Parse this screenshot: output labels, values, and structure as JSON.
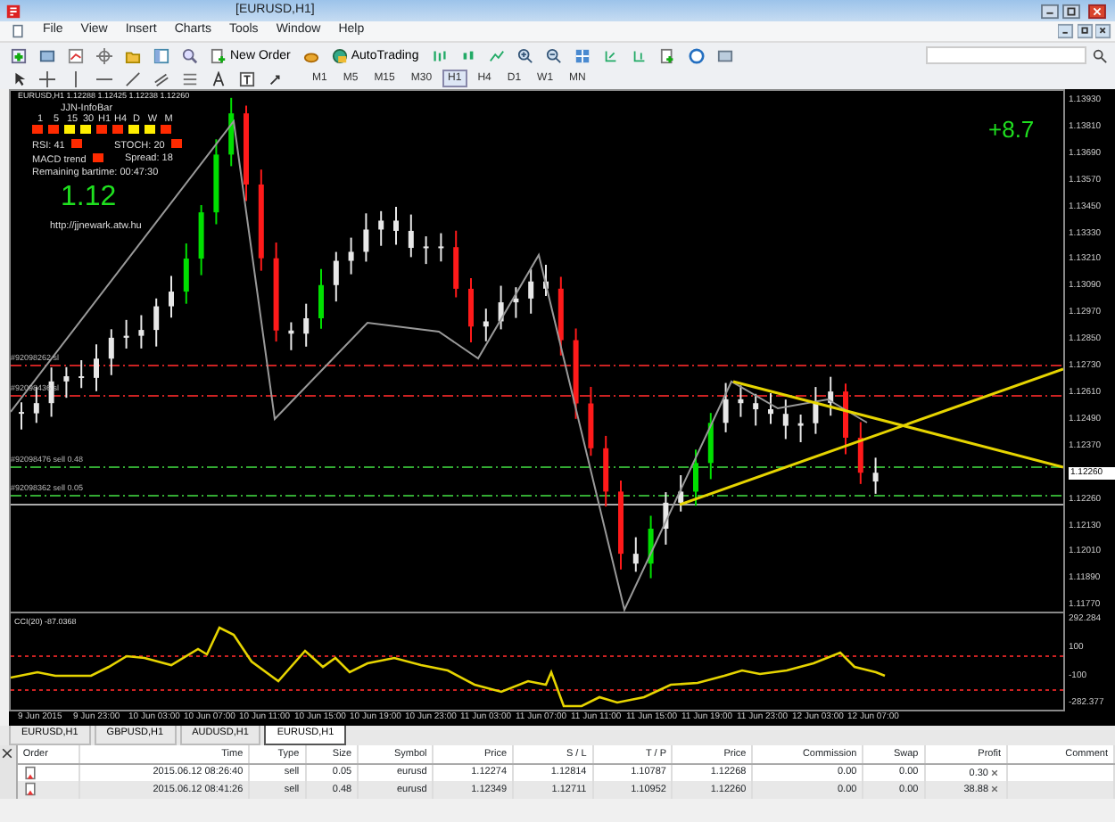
{
  "window": {
    "title": "[EURUSD,H1]"
  },
  "menu": [
    "File",
    "View",
    "Insert",
    "Charts",
    "Tools",
    "Window",
    "Help"
  ],
  "toolbar": {
    "buttons": [
      "New Order",
      "AutoTrading"
    ]
  },
  "periods": [
    {
      "label": "M1",
      "selected": false
    },
    {
      "label": "M5",
      "selected": false
    },
    {
      "label": "M15",
      "selected": false
    },
    {
      "label": "M30",
      "selected": false
    },
    {
      "label": "H1",
      "selected": true
    },
    {
      "label": "H4",
      "selected": false
    },
    {
      "label": "D1",
      "selected": false
    },
    {
      "label": "W1",
      "selected": false
    },
    {
      "label": "MN",
      "selected": false
    }
  ],
  "chart": {
    "header": "EURUSD,H1  1.12288 1.12425 1.12238 1.12260",
    "infobar": {
      "title": "JJN-InfoBar",
      "timeframes": [
        {
          "label": "1",
          "color": "#ff2a00"
        },
        {
          "label": "5",
          "color": "#ff2a00"
        },
        {
          "label": "15",
          "color": "#ffee00"
        },
        {
          "label": "30",
          "color": "#ffee00"
        },
        {
          "label": "H1",
          "color": "#ff2a00"
        },
        {
          "label": "H4",
          "color": "#ff2a00"
        },
        {
          "label": "D",
          "color": "#ffee00"
        },
        {
          "label": "W",
          "color": "#ffee00"
        },
        {
          "label": "M",
          "color": "#ff2a00"
        }
      ],
      "signals": [
        {
          "label": "RSI: 41",
          "color": "#ff2a00"
        },
        {
          "label": "STOCH: 20",
          "color": "#ff2a00"
        },
        {
          "label": "MACD trend",
          "color": "#ff2a00"
        }
      ],
      "spread": "Spread: 18",
      "bartime": "Remaining bartime:  00:47:30",
      "value": "1.12",
      "url": "http://jjnewark.atw.hu"
    },
    "profit": "+8.7",
    "order_lines": [
      "#92098262 sl",
      "#92098436 sl",
      "#92098476 sell 0.48",
      "#92098362 sell 0.05"
    ],
    "price_axis": [
      "1.13930",
      "1.13810",
      "1.13690",
      "1.13570",
      "1.13450",
      "1.13330",
      "1.13210",
      "1.13090",
      "1.12970",
      "1.12850",
      "1.12730",
      "1.12610",
      "1.12490",
      "1.12370",
      "1.12260",
      "1.12130",
      "1.12010",
      "1.11890",
      "1.11770"
    ],
    "current_price": "1.12260",
    "cci": {
      "label": "CCI(20) -87.0368",
      "axis": [
        "292.284",
        "100",
        "-100",
        "-282.377"
      ]
    },
    "time_axis": [
      "9 Jun 2015",
      "9 Jun 23:00",
      "10 Jun 03:00",
      "10 Jun 07:00",
      "10 Jun 11:00",
      "10 Jun 15:00",
      "10 Jun 19:00",
      "10 Jun 23:00",
      "11 Jun 03:00",
      "11 Jun 07:00",
      "11 Jun 11:00",
      "11 Jun 15:00",
      "11 Jun 19:00",
      "11 Jun 23:00",
      "12 Jun 03:00",
      "12 Jun 07:00"
    ]
  },
  "chart_tabs": [
    {
      "label": "EURUSD,H1",
      "selected": false
    },
    {
      "label": "GBPUSD,H1",
      "selected": false
    },
    {
      "label": "AUDUSD,H1",
      "selected": false
    },
    {
      "label": "EURUSD,H1",
      "selected": true
    }
  ],
  "orders": {
    "columns": [
      "Order",
      "Time",
      "Type",
      "Size",
      "Symbol",
      "Price",
      "S / L",
      "T / P",
      "Price",
      "Commission",
      "Swap",
      "Profit",
      "Comment"
    ],
    "rows": [
      {
        "cells": [
          "",
          "2015.06.12 08:26:40",
          "sell",
          "0.05",
          "eurusd",
          "1.12274",
          "1.12814",
          "1.10787",
          "1.12268",
          "0.00",
          "0.00",
          "0.30",
          ""
        ]
      },
      {
        "cells": [
          "",
          "2015.06.12 08:41:26",
          "sell",
          "0.48",
          "eurusd",
          "1.12349",
          "1.12711",
          "1.10952",
          "1.12260",
          "0.00",
          "0.00",
          "38.88",
          ""
        ]
      }
    ]
  }
}
